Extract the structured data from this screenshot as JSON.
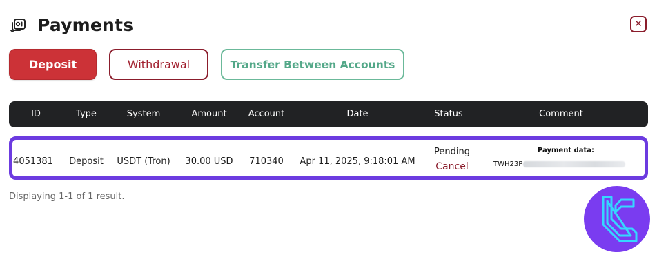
{
  "header": {
    "title": "Payments",
    "icon": "payments-icon",
    "close_icon": "close-icon"
  },
  "actions": {
    "deposit_label": "Deposit",
    "withdrawal_label": "Withdrawal",
    "transfer_label": "Transfer Between Accounts"
  },
  "table": {
    "columns": [
      "ID",
      "Type",
      "System",
      "Amount",
      "Account",
      "Date",
      "Status",
      "Comment"
    ],
    "rows": [
      {
        "id": "4051381",
        "type": "Deposit",
        "system": "USDT (Tron)",
        "amount": "30.00 USD",
        "account": "710340",
        "date": "Apr 11, 2025, 9:18:01 AM",
        "status": "Pending",
        "cancel_label": "Cancel",
        "comment_label": "Payment data:",
        "comment_value_prefix": "TWH23P"
      }
    ]
  },
  "footer": {
    "result_text": "Displaying 1-1 of 1 result."
  },
  "colors": {
    "primary_red": "#cc3237",
    "dark_red": "#8b1d2c",
    "green": "#54a889",
    "row_highlight": "#6c3be0",
    "header_bg": "#212224",
    "logo_bg": "#7a3cf0",
    "logo_fg": "#35d7ff"
  }
}
